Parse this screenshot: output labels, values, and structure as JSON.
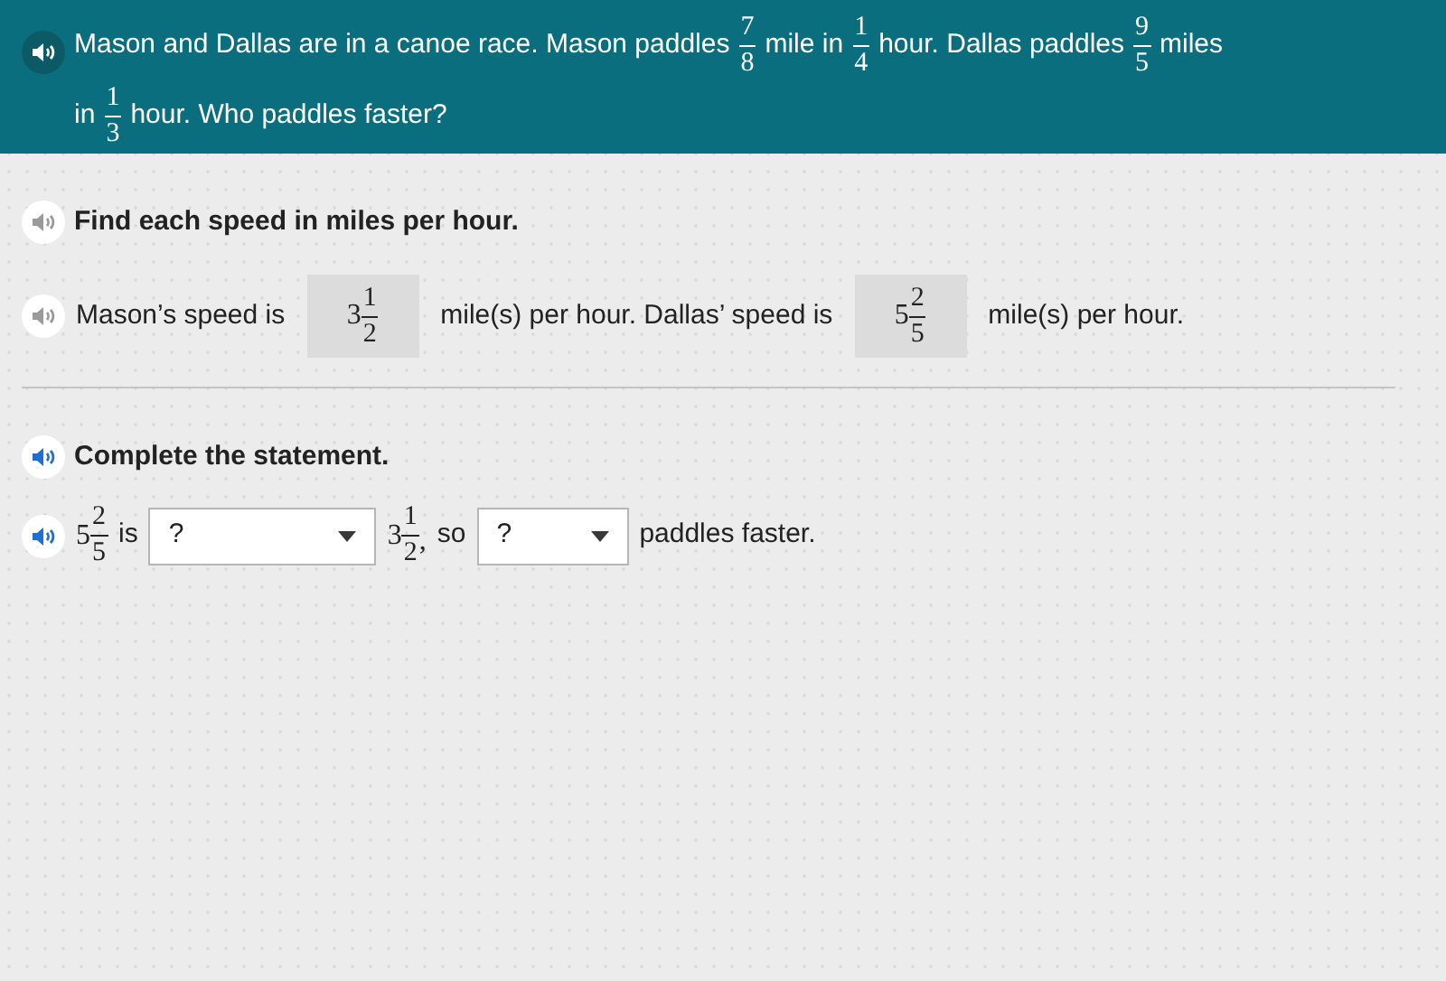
{
  "question": {
    "lines": [
      [
        {
          "kind": "text",
          "text": "Mason and Dallas are in a canoe race. Mason paddles"
        },
        {
          "kind": "fraction",
          "numerator": "7",
          "denominator": "8"
        },
        {
          "kind": "text",
          "text": "mile in"
        },
        {
          "kind": "fraction",
          "numerator": "1",
          "denominator": "4"
        },
        {
          "kind": "text",
          "text": "hour. Dallas paddles"
        },
        {
          "kind": "fraction",
          "numerator": "9",
          "denominator": "5"
        },
        {
          "kind": "text",
          "text": "miles"
        }
      ],
      [
        {
          "kind": "text",
          "text": "in"
        },
        {
          "kind": "fraction",
          "numerator": "1",
          "denominator": "3"
        },
        {
          "kind": "text",
          "text": "hour. Who paddles faster?"
        }
      ]
    ]
  },
  "parts": [
    {
      "instruction": {
        "audio": {
          "disabled": true
        },
        "text": "Find each speed in miles per hour."
      },
      "row": {
        "audio": {
          "disabled": true
        },
        "segments": [
          {
            "kind": "text",
            "text": "Mason’s speed is"
          },
          {
            "kind": "answer",
            "whole": "3",
            "numerator": "1",
            "denominator": "2"
          },
          {
            "kind": "text",
            "text": "mile(s) per hour. Dallas’ speed is"
          },
          {
            "kind": "answer",
            "whole": "5",
            "numerator": "2",
            "denominator": "5"
          },
          {
            "kind": "text",
            "text": "mile(s) per hour."
          }
        ]
      }
    },
    {
      "instruction": {
        "audio": {
          "disabled": false
        },
        "text": "Complete the statement."
      },
      "row": {
        "audio": {
          "disabled": false
        },
        "segments": [
          {
            "kind": "mixed",
            "whole": "5",
            "numerator": "2",
            "denominator": "5"
          },
          {
            "kind": "text",
            "text": "is"
          },
          {
            "kind": "dropdown",
            "value": "?"
          },
          {
            "kind": "mixed",
            "whole": "3",
            "numerator": "1",
            "denominator": "2",
            "suffix": ","
          },
          {
            "kind": "text",
            "text": "so"
          },
          {
            "kind": "dropdown",
            "value": "?"
          },
          {
            "kind": "text",
            "text": "paddles faster."
          }
        ]
      }
    }
  ]
}
